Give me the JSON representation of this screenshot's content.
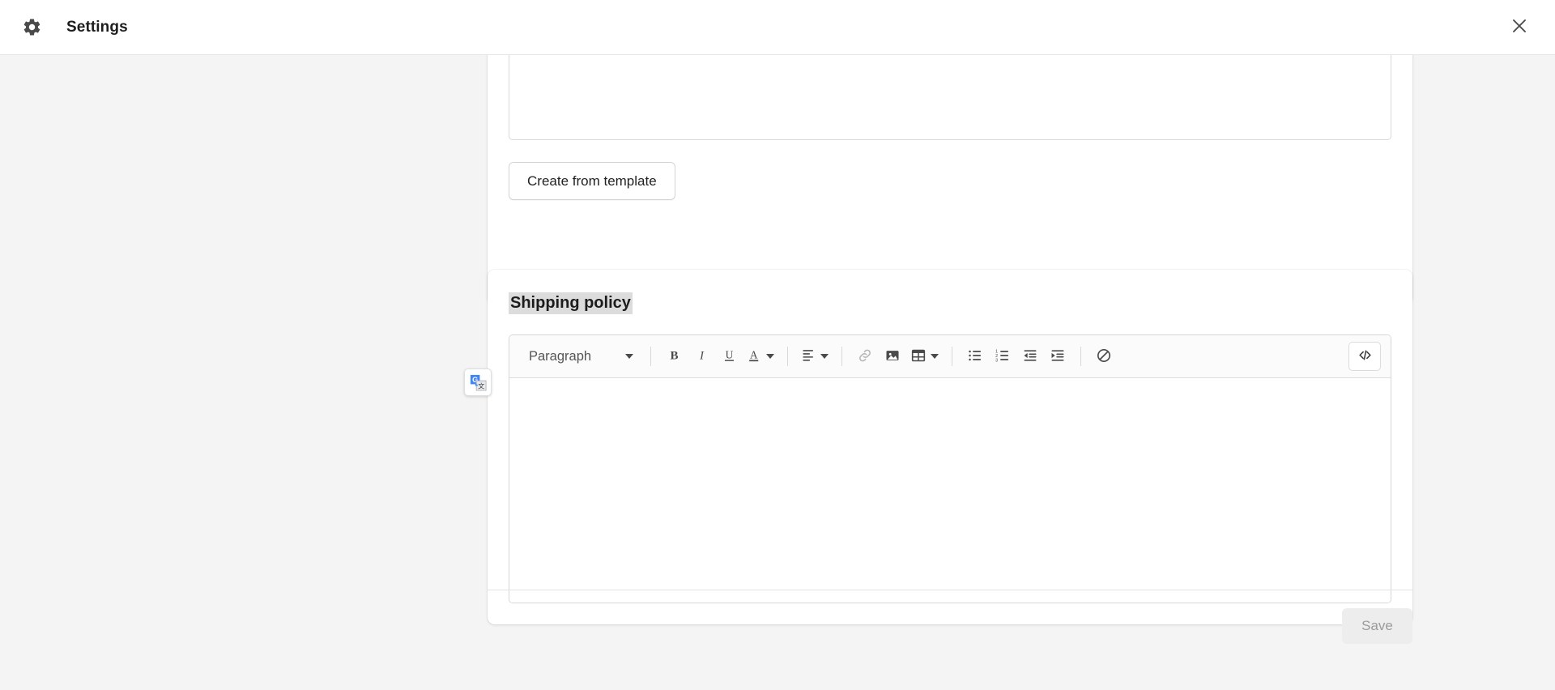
{
  "window": {
    "title": "Settings",
    "gear_icon": "gear-icon",
    "close_icon": "close-x-icon"
  },
  "top_card": {
    "template_button_label": "Create from template",
    "editor_value": "",
    "editor_placeholder": ""
  },
  "shipping_section": {
    "heading": "Shipping policy",
    "heading_highlight_color": "#dcdcdc",
    "editor": {
      "value": "",
      "placeholder": "",
      "toolbar": {
        "block_format_label": "Paragraph",
        "items": [
          {
            "name": "bold-button",
            "label": "B",
            "icon": "bold-icon",
            "enabled": true
          },
          {
            "name": "italic-button",
            "label": "I",
            "icon": "italic-icon",
            "enabled": true
          },
          {
            "name": "underline-button",
            "label": "U",
            "icon": "underline-icon",
            "enabled": true
          },
          {
            "name": "text-color-button",
            "label": "A",
            "icon": "text-color-icon",
            "enabled": true
          },
          {
            "name": "align-button",
            "label": "",
            "icon": "align-left-icon",
            "enabled": true
          },
          {
            "name": "link-button",
            "label": "",
            "icon": "link-icon",
            "enabled": false
          },
          {
            "name": "image-button",
            "label": "",
            "icon": "image-icon",
            "enabled": true
          },
          {
            "name": "table-button",
            "label": "",
            "icon": "table-icon",
            "enabled": true
          },
          {
            "name": "bullet-list-button",
            "label": "",
            "icon": "bullet-list-icon",
            "enabled": true
          },
          {
            "name": "numbered-list-button",
            "label": "",
            "icon": "numbered-list-icon",
            "enabled": true
          },
          {
            "name": "outdent-button",
            "label": "",
            "icon": "outdent-icon",
            "enabled": true
          },
          {
            "name": "indent-button",
            "label": "",
            "icon": "indent-icon",
            "enabled": true
          },
          {
            "name": "clear-format-button",
            "label": "",
            "icon": "clear-formatting-icon",
            "enabled": true
          },
          {
            "name": "code-view-button",
            "label": "</>",
            "icon": "code-view-icon",
            "enabled": true
          }
        ]
      }
    }
  },
  "footer": {
    "save_label": "Save",
    "save_enabled": false
  },
  "extension": {
    "name": "google-translate-icon",
    "primary_color": "#4285f4"
  }
}
